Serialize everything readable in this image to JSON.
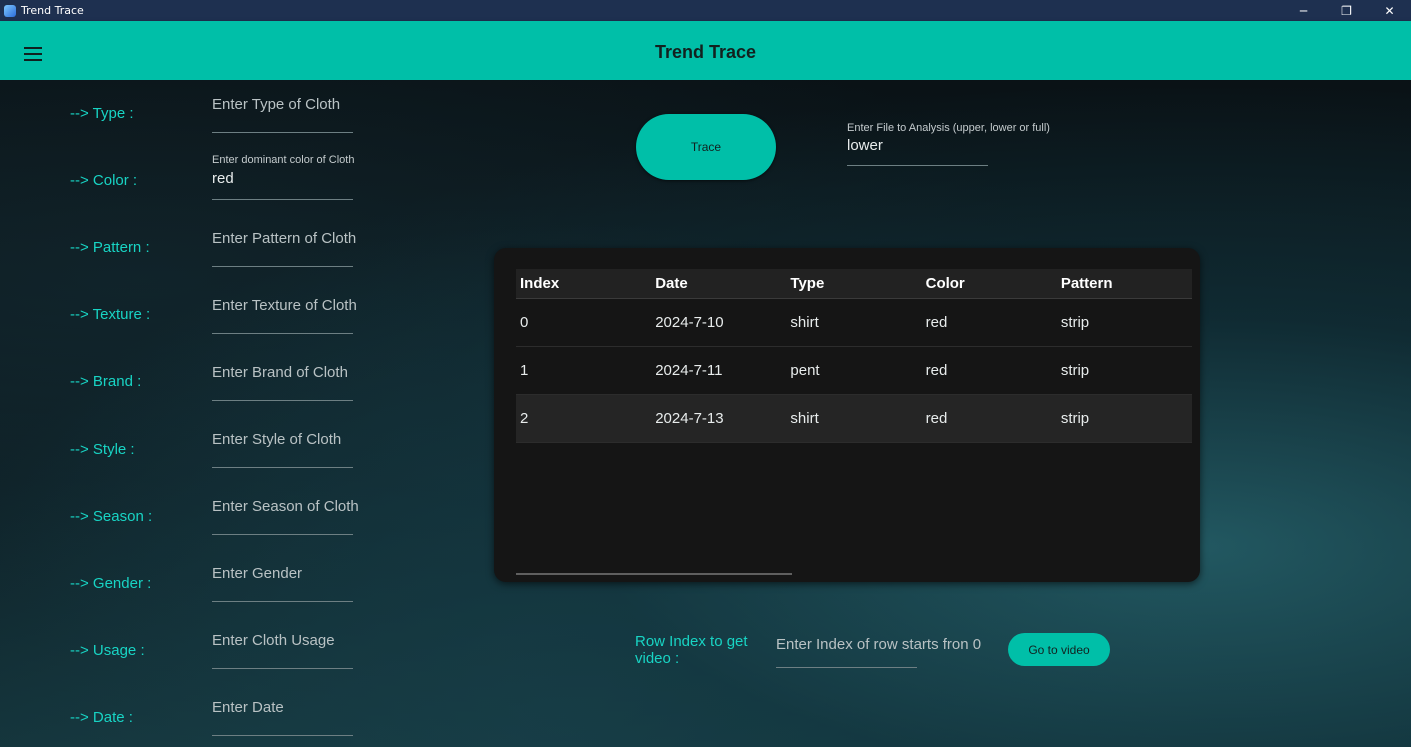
{
  "window": {
    "title": "Trend Trace",
    "controls": {
      "minimize": "─",
      "restore": "❐",
      "close": "✕"
    }
  },
  "appbar": {
    "title": "Trend Trace",
    "menu_icon": "hamburger-icon"
  },
  "form": {
    "fields": [
      {
        "label": "--> Type :",
        "placeholder": "Enter Type of Cloth",
        "value": ""
      },
      {
        "label": "--> Color :",
        "hint": "Enter dominant color of Cloth",
        "value": "red"
      },
      {
        "label": "--> Pattern :",
        "placeholder": "Enter Pattern of Cloth",
        "value": ""
      },
      {
        "label": "--> Texture :",
        "placeholder": "Enter Texture of Cloth",
        "value": ""
      },
      {
        "label": "--> Brand :",
        "placeholder": "Enter Brand of Cloth",
        "value": ""
      },
      {
        "label": "--> Style :",
        "placeholder": "Enter Style of Cloth",
        "value": ""
      },
      {
        "label": "--> Season :",
        "placeholder": "Enter Season of Cloth",
        "value": ""
      },
      {
        "label": "--> Gender :",
        "placeholder": "Enter Gender",
        "value": ""
      },
      {
        "label": "--> Usage :",
        "placeholder": "Enter Cloth Usage",
        "value": ""
      },
      {
        "label": "--> Date :",
        "placeholder": "Enter Date",
        "value": ""
      }
    ]
  },
  "trace_button": {
    "label": "Trace"
  },
  "file_analysis": {
    "hint": "Enter File to Analysis (upper, lower or full)",
    "value": "lower"
  },
  "table": {
    "columns": [
      "Index",
      "Date",
      "Type",
      "Color",
      "Pattern"
    ],
    "rows": [
      [
        "0",
        "2024-7-10",
        "shirt",
        "red",
        "strip"
      ],
      [
        "1",
        "2024-7-11",
        "pent",
        "red",
        "strip"
      ],
      [
        "2",
        "2024-7-13",
        "shirt",
        "red",
        "strip"
      ]
    ]
  },
  "video": {
    "label": "Row Index to get video :",
    "placeholder": "Enter Index of row starts fron 0",
    "button_label": "Go to video"
  },
  "colors": {
    "accent": "#00bfa8",
    "label_text": "#18d4c4",
    "titlebar": "#1e3050"
  }
}
